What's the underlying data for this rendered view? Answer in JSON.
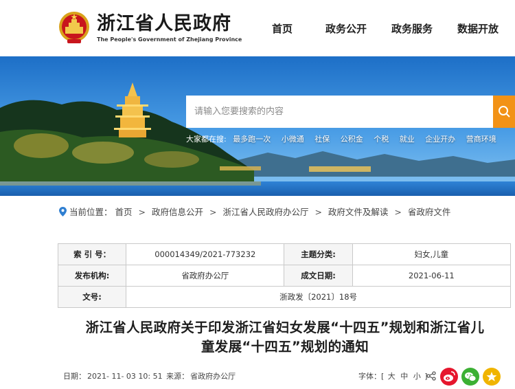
{
  "header": {
    "site_title": "浙江省人民政府",
    "site_subtitle": "The People's Government of Zhejiang Province",
    "nav": [
      "首页",
      "政务公开",
      "政务服务",
      "数据开放"
    ]
  },
  "search": {
    "placeholder": "请输入您要搜索的内容",
    "hot_label": "大家都在搜:",
    "hot_items": [
      "最多跑一次",
      "小微通",
      "社保",
      "公积金",
      "个税",
      "就业",
      "企业开办",
      "营商环境"
    ]
  },
  "breadcrumb": {
    "prefix": "当前位置：",
    "items": [
      "首页",
      "政府信息公开",
      "浙江省人民政府办公厅",
      "政府文件及解读",
      "省政府文件"
    ],
    "separator": ">"
  },
  "info": {
    "index_label": "索 引 号：",
    "index_value": "000014349/2021-773232",
    "topic_label": "主题分类:",
    "topic_value": "妇女,儿童",
    "publisher_label": "发布机构:",
    "publisher_value": "省政府办公厅",
    "date_label": "成文日期:",
    "date_value": "2021-06-11",
    "docno_label": "文号:",
    "docno_value": "浙政发〔2021〕18号"
  },
  "document": {
    "title_line1": "浙江省人民政府关于印发浙江省妇女发展“十四五”规划和浙江省儿",
    "title_line2": "童发展“十四五”规划的通知"
  },
  "meta": {
    "date_label": "日期：",
    "date_value": "2021- 11- 03 10: 51",
    "source_label": "来源：",
    "source_value": "省政府办公厅",
    "font_label": "字体：",
    "font_open": "[",
    "font_large": "大",
    "font_medium": "中",
    "font_small": "小",
    "font_close": "]"
  },
  "colors": {
    "accent_orange": "#f29216",
    "weibo_red": "#e6162d",
    "wechat_green": "#3cb034",
    "favorite_gold": "#f0b400"
  },
  "icons": [
    "location-pin-icon",
    "search-icon",
    "share-icon",
    "weibo-icon",
    "wechat-icon",
    "star-icon"
  ]
}
